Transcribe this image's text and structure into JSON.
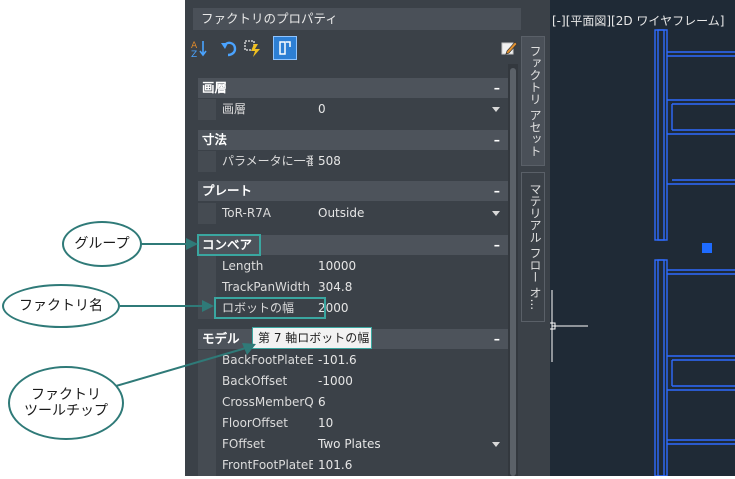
{
  "palette": {
    "title": "ファクトリのプロパティ",
    "toolbar": [
      {
        "icon": "sort-az-icon"
      },
      {
        "icon": "undo-icon"
      },
      {
        "icon": "quick-select-icon"
      },
      {
        "icon": "factory-properties-icon"
      },
      {
        "icon": "edit-icon"
      }
    ],
    "categories": {
      "layer": {
        "label": "画層",
        "collapse": "–",
        "rows": [
          {
            "name": "画層",
            "value": "0",
            "dropdown": true
          }
        ]
      },
      "dimension": {
        "label": "寸法",
        "collapse": "–",
        "rows": [
          {
            "name": "パラメータに一番",
            "value": "508"
          }
        ]
      },
      "plate": {
        "label": "プレート",
        "collapse": "–",
        "rows": [
          {
            "name": "ToR-R7A",
            "value": "Outside",
            "dropdown": true
          }
        ]
      },
      "conveyor": {
        "label": "コンベア",
        "collapse": "–",
        "rows": [
          {
            "name": "Length",
            "value": "10000"
          },
          {
            "name": "TrackPanWidth",
            "value": "304.8"
          },
          {
            "name": "ロボットの幅",
            "value": "2000"
          }
        ]
      },
      "model": {
        "label": "モデル",
        "collapse": "–",
        "rows": [
          {
            "name": "BackFootPlateE",
            "value": "-101.6"
          },
          {
            "name": "BackOffset",
            "value": "-1000"
          },
          {
            "name": "CrossMemberQ",
            "value": "6"
          },
          {
            "name": "FloorOffset",
            "value": "10"
          },
          {
            "name": "FOffset",
            "value": "Two Plates",
            "dropdown": true
          },
          {
            "name": "FrontFootPlateE",
            "value": "101.6"
          }
        ]
      }
    },
    "tooltip": "第 7 軸ロボットの幅",
    "side_tabs": [
      "ファクトリ アセット",
      "マテリアル フロー オ..."
    ]
  },
  "viewport": {
    "label": "[-][平面図][2D ワイヤフレーム]",
    "colors": {
      "background": "#1f2a36",
      "lines": "#2f6bff",
      "selection": "#1e6bff"
    }
  },
  "callouts": {
    "group": "グループ",
    "factory_name": "ファクトリ名",
    "factory_tooltip_line1": "ファクトリ",
    "factory_tooltip_line2": "ツールチップ"
  },
  "colors": {
    "accent": "#2f7a78",
    "highlight": "#3aa6a0"
  }
}
